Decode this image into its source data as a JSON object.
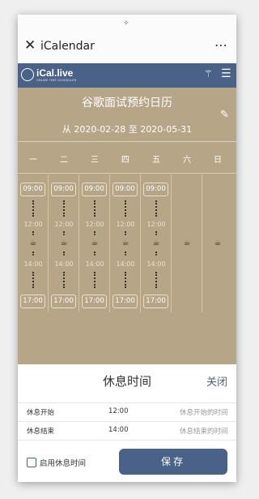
{
  "window": {
    "title": "iCalendar",
    "close_glyph": "✕",
    "more_glyph": "⋯",
    "status_glyph": "✧"
  },
  "header": {
    "logo_text": "iCal.live",
    "logo_tagline": "ONLINE TIME SCHEDULER",
    "wand_glyph": "⚚",
    "menu_glyph": "☰",
    "brand_color": "#4a6287",
    "background_color": "#b6a587"
  },
  "calendar": {
    "title": "谷歌面试预约日历",
    "range": "从 2020-02-28 至 2020-05-31",
    "edit_glyph": "✎",
    "weekdays": [
      "一",
      "二",
      "三",
      "四",
      "五",
      "六",
      "日"
    ],
    "start_time": "09:00",
    "break_start": "12:00",
    "break_end": "14:00",
    "end_time": "17:00",
    "break_icon": "coffee-cup",
    "break_glyph": "☕"
  },
  "sheet": {
    "title": "休息时间",
    "close_label": "关闭",
    "rows": [
      {
        "label": "休息开始",
        "value": "12:00",
        "hint": "休息开始的时间"
      },
      {
        "label": "休息结束",
        "value": "14:00",
        "hint": "休息结束的时间"
      }
    ],
    "checkbox_label": "启用休息时间",
    "checkbox_checked": false,
    "save_label": "保存"
  }
}
